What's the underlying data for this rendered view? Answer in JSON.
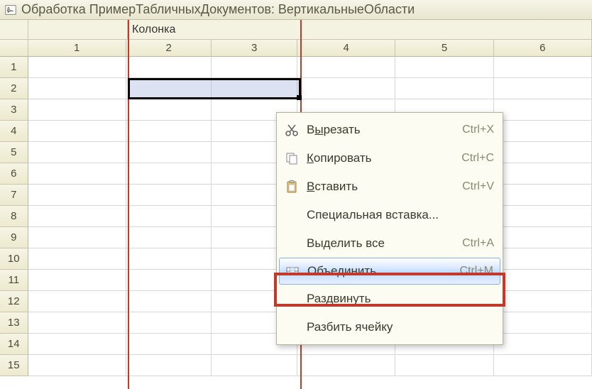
{
  "window": {
    "title": "Обработка ПримерТабличныхДокументов: ВертикальныеОбласти"
  },
  "named_area": {
    "label": "Колонка"
  },
  "columns": [
    "1",
    "2",
    "3",
    "4",
    "5",
    "6"
  ],
  "rows": [
    "1",
    "2",
    "3",
    "4",
    "5",
    "6",
    "7",
    "8",
    "9",
    "10",
    "11",
    "12",
    "13",
    "14",
    "15"
  ],
  "context_menu": {
    "items": [
      {
        "label": "Вырезать",
        "mnemonic_index": 1,
        "shortcut": "Ctrl+X",
        "icon": "cut-icon"
      },
      {
        "label": "Копировать",
        "mnemonic_index": 0,
        "shortcut": "Ctrl+C",
        "icon": "copy-icon"
      },
      {
        "label": "Вставить",
        "mnemonic_index": 0,
        "shortcut": "Ctrl+V",
        "icon": "paste-icon"
      },
      {
        "label": "Специальная вставка...",
        "mnemonic_index": -1,
        "shortcut": "",
        "icon": ""
      },
      {
        "label": "Выделить все",
        "mnemonic_index": -1,
        "shortcut": "Ctrl+A",
        "icon": ""
      },
      {
        "label": "Объединить",
        "mnemonic_index": -1,
        "shortcut": "Ctrl+M",
        "icon": "merge-icon",
        "highlight": true
      },
      {
        "label": "Раздвинуть",
        "mnemonic_index": -1,
        "shortcut": "",
        "icon": ""
      },
      {
        "label": "Разбить ячейку",
        "mnemonic_index": -1,
        "shortcut": "",
        "icon": ""
      }
    ]
  }
}
